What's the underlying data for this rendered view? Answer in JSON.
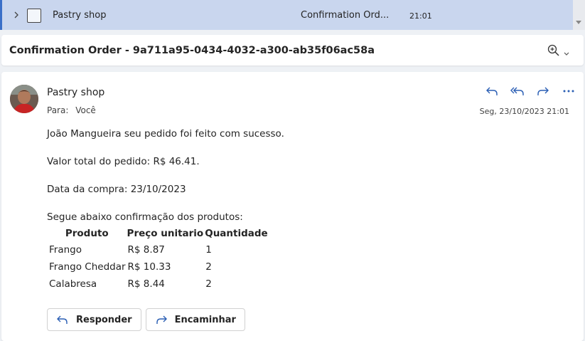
{
  "list_item": {
    "sender": "Pastry shop",
    "subject": "Confirmation Ord...",
    "time": "21:01"
  },
  "subject_header": {
    "title": "Confirmation Order - 9a711a95-0434-4032-a300-ab35f06ac58a"
  },
  "message": {
    "sender": "Pastry shop",
    "to_label": "Para:",
    "to_value": "Você",
    "date": "Seg, 23/10/2023 21:01",
    "body": {
      "line1": "João Mangueira seu pedido foi feito com sucesso.",
      "line2": "Valor total do pedido: R$ 46.41.",
      "line3": "Data da compra: 23/10/2023",
      "line4": "Segue abaixo confirmação dos produtos:"
    },
    "table": {
      "headers": [
        "Produto",
        "Preço unitario",
        "Quantidade"
      ],
      "rows": [
        [
          "Frango",
          "R$ 8.87",
          "1"
        ],
        [
          "Frango Cheddar",
          "R$ 10.33",
          "2"
        ],
        [
          "Calabresa",
          "R$ 8.44",
          "2"
        ]
      ]
    },
    "buttons": {
      "reply": "Responder",
      "forward": "Encaminhar"
    }
  },
  "icons": {
    "reply": "reply-icon",
    "reply_all": "reply-all-icon",
    "forward": "forward-icon",
    "more": "more-icon",
    "zoom": "zoom-icon"
  },
  "colors": {
    "selected_row": "#c9d6ee",
    "accent": "#3a6fc8",
    "icon_blue": "#2b5fb4"
  }
}
